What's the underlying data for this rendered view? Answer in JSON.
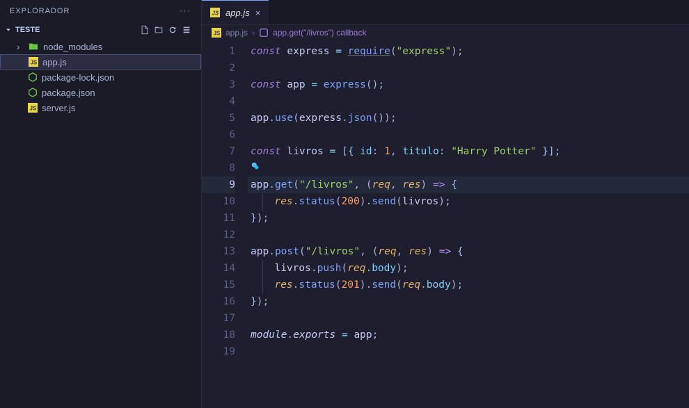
{
  "explorer": {
    "title": "EXPLORADOR",
    "section": "TESTE",
    "items": [
      {
        "label": "node_modules",
        "type": "folder"
      },
      {
        "label": "app.js",
        "type": "js",
        "active": true
      },
      {
        "label": "package-lock.json",
        "type": "json"
      },
      {
        "label": "package.json",
        "type": "json"
      },
      {
        "label": "server.js",
        "type": "js"
      }
    ]
  },
  "tabs": {
    "active": {
      "label": "app.js",
      "close": "×"
    }
  },
  "breadcrumbs": {
    "file": "app.js",
    "symbol": "app.get(\"/livros\") callback",
    "sep": "›"
  },
  "editor": {
    "lineNumbers": [
      "1",
      "2",
      "3",
      "4",
      "5",
      "6",
      "7",
      "8",
      "9",
      "10",
      "11",
      "12",
      "13",
      "14",
      "15",
      "16",
      "17",
      "18",
      "19"
    ],
    "currentLine": 9,
    "code": {
      "l1": {
        "const": "const ",
        "var": "express",
        "eq": " = ",
        "fn": "require",
        "lp": "(",
        "str": "\"express\"",
        "rp": ")",
        "sc": ";"
      },
      "l3": {
        "const": "const ",
        "var": "app",
        "eq": " = ",
        "fn": "express",
        "lp": "(",
        "rp": ")",
        "sc": ";"
      },
      "l5": {
        "obj": "app",
        "dot1": ".",
        "m1": "use",
        "lp1": "(",
        "obj2": "express",
        "dot2": ".",
        "m2": "json",
        "lp2": "(",
        "rp2": ")",
        "rp1": ")",
        "sc": ";"
      },
      "l7": {
        "const": "const ",
        "var": "livros",
        "eq": " = ",
        "lb": "[",
        "lc": "{ ",
        "k1": "id",
        "c1": ": ",
        "n1": "1",
        "cm": ", ",
        "k2": "titulo",
        "c2": ": ",
        "s1": "\"Harry Potter\"",
        "rc": " }",
        "rb": "]",
        "sc": ";"
      },
      "l9": {
        "obj": "app",
        "dot": ".",
        "m": "get",
        "lp": "(",
        "str": "\"/livros\"",
        "cm": ", ",
        "la": "(",
        "p1": "req",
        "pc": ", ",
        "p2": "res",
        "ra": ")",
        "ar": " => ",
        "lc": "{"
      },
      "l10": {
        "obj": "res",
        "d1": ".",
        "m1": "status",
        "lp1": "(",
        "n": "200",
        "rp1": ")",
        "d2": ".",
        "m2": "send",
        "lp2": "(",
        "arg": "livros",
        "rp2": ")",
        "sc": ";"
      },
      "l11": {
        "rc": "}",
        "rp": ")",
        "sc": ";"
      },
      "l13": {
        "obj": "app",
        "dot": ".",
        "m": "post",
        "lp": "(",
        "str": "\"/livros\"",
        "cm": ", ",
        "la": "(",
        "p1": "req",
        "pc": ", ",
        "p2": "res",
        "ra": ")",
        "ar": " => ",
        "lc": "{"
      },
      "l14": {
        "obj": "livros",
        "d1": ".",
        "m1": "push",
        "lp1": "(",
        "arg1": "req",
        "d2": ".",
        "p": "body",
        "rp1": ")",
        "sc": ";"
      },
      "l15": {
        "obj": "res",
        "d1": ".",
        "m1": "status",
        "lp1": "(",
        "n": "201",
        "rp1": ")",
        "d2": ".",
        "m2": "send",
        "lp2": "(",
        "arg": "req",
        "d3": ".",
        "p": "body",
        "rp2": ")",
        "sc": ";"
      },
      "l16": {
        "rc": "}",
        "rp": ")",
        "sc": ";"
      },
      "l18": {
        "mod": "module",
        "d": ".",
        "exp": "exports",
        "eq": " = ",
        "v": "app",
        "sc": ";"
      }
    }
  }
}
